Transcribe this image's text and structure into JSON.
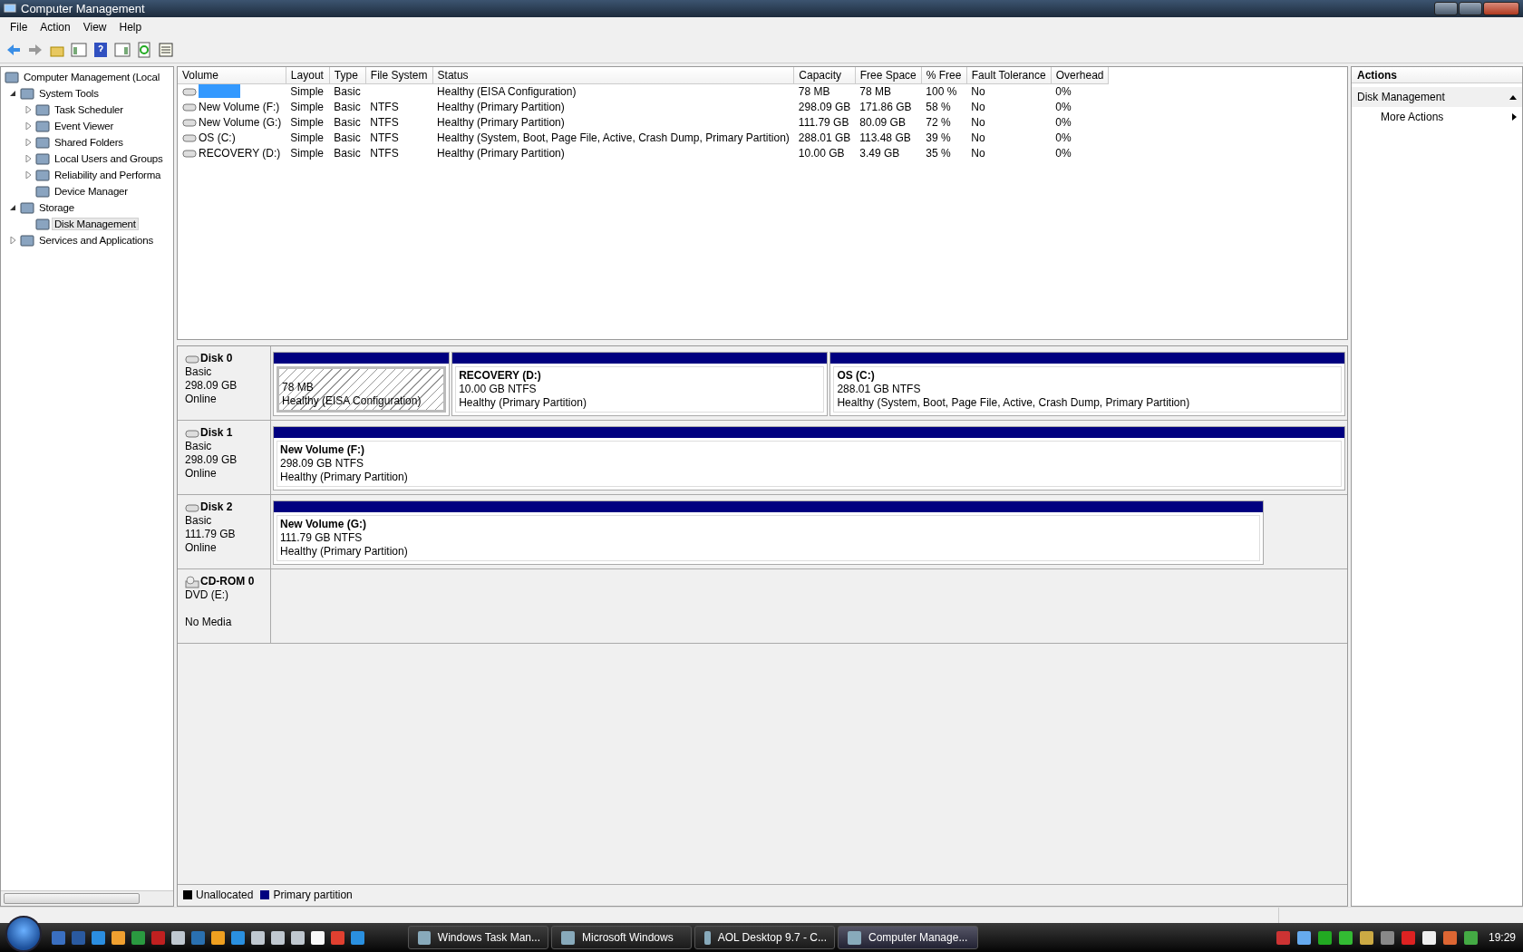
{
  "window": {
    "title": "Computer Management"
  },
  "menu": [
    "File",
    "Action",
    "View",
    "Help"
  ],
  "tree": [
    {
      "label": "Computer Management (Local",
      "selected": false,
      "children": [
        {
          "label": "System Tools",
          "expanded": true,
          "selected": false,
          "children": [
            {
              "label": "Task Scheduler",
              "expanded": false,
              "selected": false
            },
            {
              "label": "Event Viewer",
              "expanded": false,
              "selected": false
            },
            {
              "label": "Shared Folders",
              "expanded": false,
              "selected": false
            },
            {
              "label": "Local Users and Groups",
              "expanded": false,
              "selected": false
            },
            {
              "label": "Reliability and Performa",
              "expanded": false,
              "selected": false
            },
            {
              "label": "Device Manager",
              "selected": false
            }
          ]
        },
        {
          "label": "Storage",
          "expanded": true,
          "selected": false,
          "children": [
            {
              "label": "Disk Management",
              "selected": true
            }
          ]
        },
        {
          "label": "Services and Applications",
          "expanded": false,
          "selected": false
        }
      ]
    }
  ],
  "table": {
    "columns": [
      "Volume",
      "Layout",
      "Type",
      "File System",
      "Status",
      "Capacity",
      "Free Space",
      "% Free",
      "Fault Tolerance",
      "Overhead"
    ],
    "rows": [
      {
        "selected": true,
        "cells": [
          "",
          "Simple",
          "Basic",
          "",
          "Healthy (EISA Configuration)",
          "78 MB",
          "78 MB",
          "100 %",
          "No",
          "0%"
        ]
      },
      {
        "selected": false,
        "cells": [
          "New Volume (F:)",
          "Simple",
          "Basic",
          "NTFS",
          "Healthy (Primary Partition)",
          "298.09 GB",
          "171.86 GB",
          "58 %",
          "No",
          "0%"
        ]
      },
      {
        "selected": false,
        "cells": [
          "New Volume (G:)",
          "Simple",
          "Basic",
          "NTFS",
          "Healthy (Primary Partition)",
          "111.79 GB",
          "80.09 GB",
          "72 %",
          "No",
          "0%"
        ]
      },
      {
        "selected": false,
        "cells": [
          "OS (C:)",
          "Simple",
          "Basic",
          "NTFS",
          "Healthy (System, Boot, Page File, Active, Crash Dump, Primary Partition)",
          "288.01 GB",
          "113.48 GB",
          "39 %",
          "No",
          "0%"
        ]
      },
      {
        "selected": false,
        "cells": [
          "RECOVERY (D:)",
          "Simple",
          "Basic",
          "NTFS",
          "Healthy (Primary Partition)",
          "10.00 GB",
          "3.49 GB",
          "35 %",
          "No",
          "0%"
        ]
      }
    ]
  },
  "disks": [
    {
      "kind": "disk",
      "name": "Disk 0",
      "lines": [
        "Basic",
        "298.09 GB",
        "Online"
      ],
      "partitions": [
        {
          "kind": "eisa",
          "lines": [
            "78 MB",
            "Healthy (EISA Configuration)"
          ]
        },
        {
          "kind": "primary",
          "title": "RECOVERY  (D:)",
          "lines": [
            "10.00 GB NTFS",
            "Healthy (Primary Partition)"
          ]
        },
        {
          "kind": "primary",
          "title": "OS  (C:)",
          "lines": [
            "288.01 GB NTFS",
            "Healthy (System, Boot, Page File, Active, Crash Dump, Primary Partition)"
          ]
        }
      ]
    },
    {
      "kind": "disk",
      "name": "Disk 1",
      "lines": [
        "Basic",
        "298.09 GB",
        "Online"
      ],
      "partitions": [
        {
          "kind": "primary",
          "title": "New Volume  (F:)",
          "lines": [
            "298.09 GB NTFS",
            "Healthy (Primary Partition)"
          ]
        }
      ]
    },
    {
      "kind": "disk",
      "name": "Disk 2",
      "lines": [
        "Basic",
        "111.79 GB",
        "Online"
      ],
      "partitions": [
        {
          "kind": "primary",
          "title": "New Volume  (G:)",
          "lines": [
            "111.79 GB NTFS",
            "Healthy (Primary Partition)"
          ]
        }
      ]
    },
    {
      "kind": "cdrom",
      "name": "CD-ROM 0",
      "lines": [
        "DVD (E:)",
        "No Media"
      ]
    }
  ],
  "legend": [
    {
      "label": "Unallocated",
      "color": "#000000"
    },
    {
      "label": "Primary partition",
      "color": "#000080"
    }
  ],
  "actions": {
    "title": "Actions",
    "section": "Disk Management",
    "items": [
      "More Actions"
    ]
  },
  "taskbar": {
    "tasks": [
      {
        "label": "Windows Task Man...",
        "selected": false
      },
      {
        "label": "Microsoft Windows",
        "selected": false
      },
      {
        "label": "AOL Desktop 9.7 - C...",
        "selected": false
      },
      {
        "label": "Computer Manage...",
        "selected": true
      }
    ],
    "clock": "19:29"
  }
}
